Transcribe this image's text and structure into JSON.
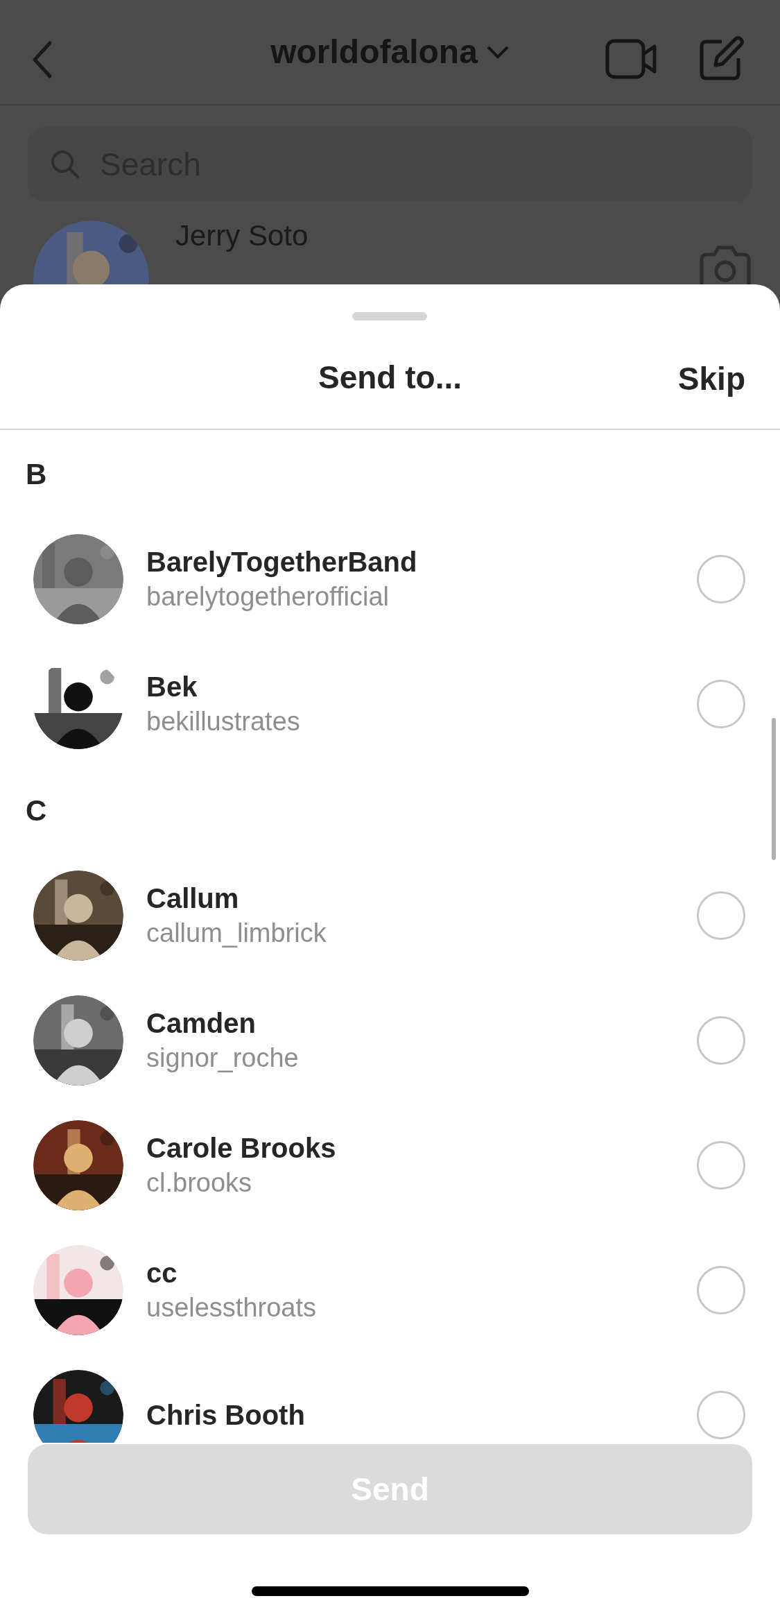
{
  "background_screen": {
    "title": "worldofalona",
    "search": {
      "placeholder": "Search"
    },
    "conversations": [
      {
        "name": "Jerry Soto"
      }
    ]
  },
  "sheet": {
    "title": "Send to...",
    "skip_button": "Skip",
    "sections": [
      {
        "letter": "B",
        "contacts": [
          {
            "name": "BarelyTogetherBand",
            "username": "barelytogetherofficial",
            "selected": false
          },
          {
            "name": "Bek",
            "username": "bekillustrates",
            "selected": false
          }
        ]
      },
      {
        "letter": "C",
        "contacts": [
          {
            "name": "Callum",
            "username": "callum_limbrick",
            "selected": false
          },
          {
            "name": "Camden",
            "username": "signor_roche",
            "selected": false
          },
          {
            "name": "Carole Brooks",
            "username": "cl.brooks",
            "selected": false
          },
          {
            "name": "cc",
            "username": "uselessthroats",
            "selected": false
          },
          {
            "name": "Chris Booth",
            "selected": false
          }
        ]
      }
    ],
    "send_button": {
      "label": "Send",
      "disabled": true
    }
  }
}
